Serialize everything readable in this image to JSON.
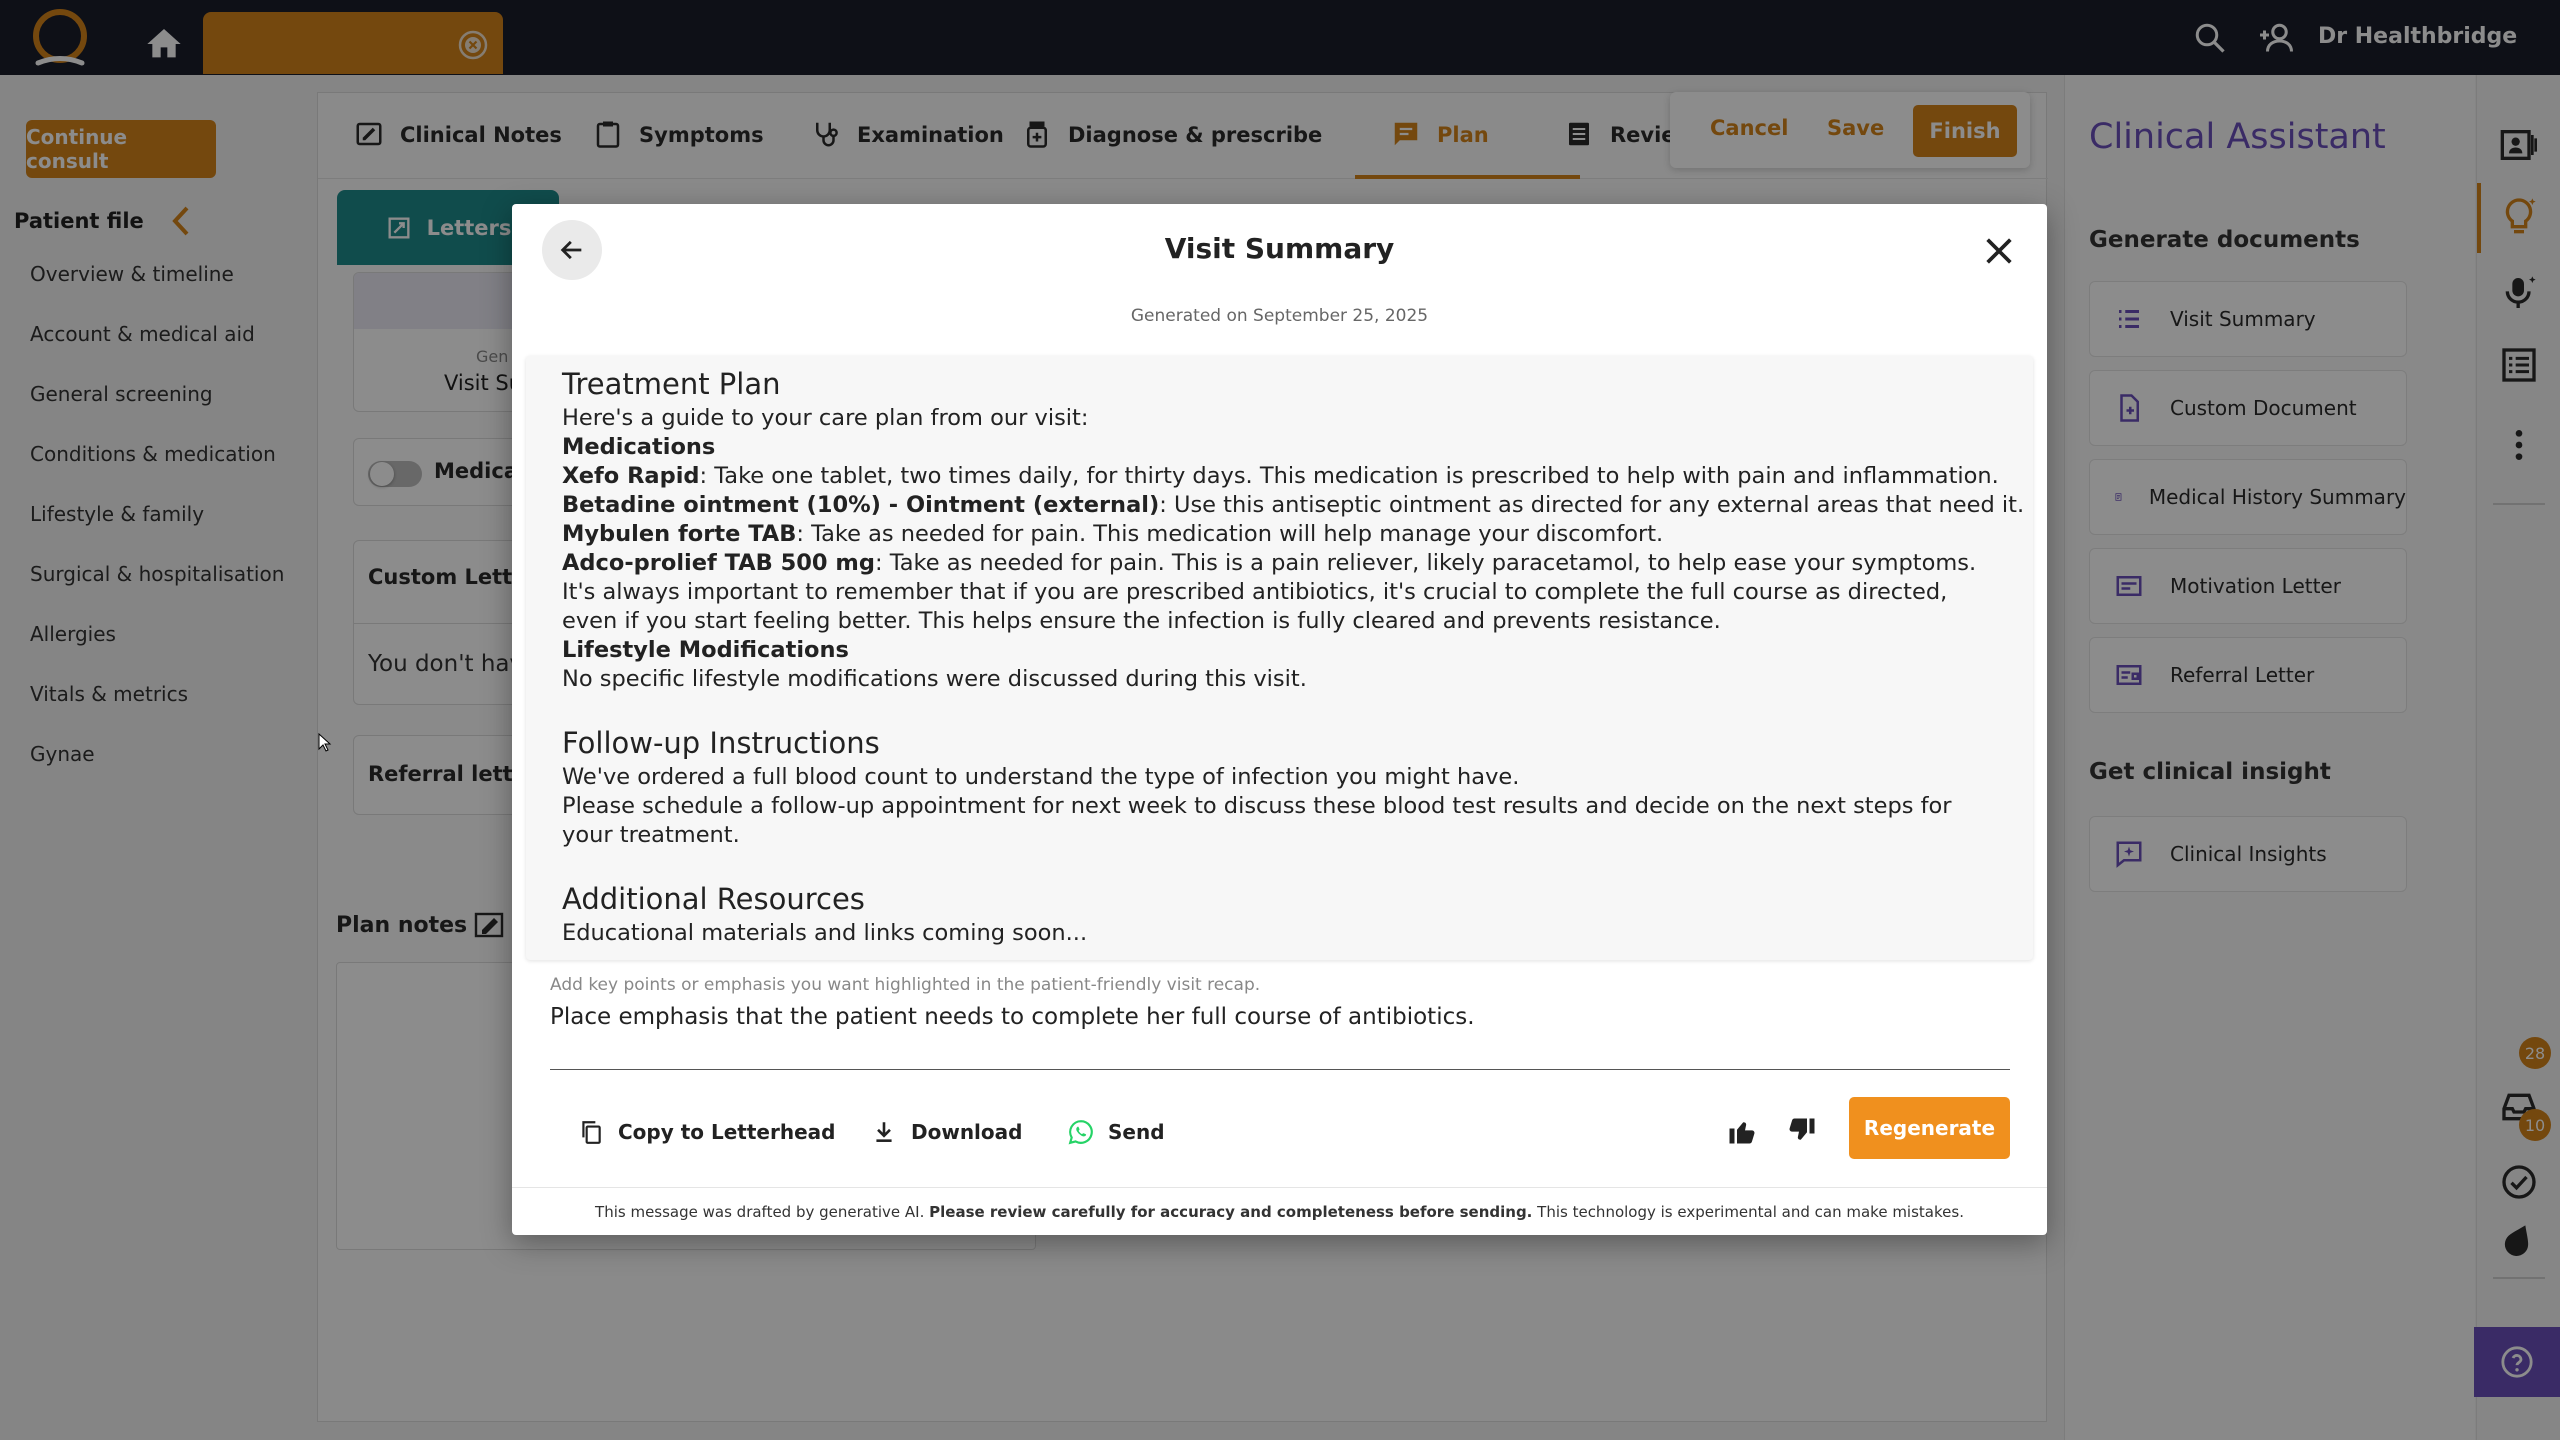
{
  "topbar": {
    "user_name": "Dr Healthbridge",
    "patient_tab_label": ""
  },
  "left_sidebar": {
    "continue_label": "Continue consult",
    "patient_file_title": "Patient file",
    "nav": [
      "Overview & timeline",
      "Account & medical aid",
      "General screening",
      "Conditions & medication",
      "Lifestyle & family",
      "Surgical & hospitalisation",
      "Allergies",
      "Vitals & metrics",
      "Gynae"
    ]
  },
  "consult": {
    "tabs": [
      "Clinical Notes",
      "Symptoms",
      "Examination",
      "Diagnose & prescribe",
      "Plan",
      "Review"
    ],
    "active_tab": "Plan",
    "cancel_label": "Cancel",
    "save_label": "Save",
    "finish_label": "Finish",
    "letters_tab": "Letters",
    "gen_card_small": "Gen",
    "gen_card_title": "Visit Su",
    "medica_label": "Medica",
    "custom_letters_title": "Custom Lette",
    "custom_letters_empty": "You don't hav",
    "referral_title": "Referral letter",
    "plan_notes_label": "Plan notes"
  },
  "assistant": {
    "title": "Clinical Assistant",
    "generate_heading": "Generate documents",
    "documents": [
      "Visit Summary",
      "Custom Document",
      "Medical History Summary",
      "Motivation Letter",
      "Referral Letter"
    ],
    "insight_heading": "Get clinical insight",
    "insight_button": "Clinical Insights"
  },
  "rail": {
    "badge_notifications": "28",
    "badge_tasks": "10"
  },
  "modal": {
    "title": "Visit Summary",
    "generated_on": "Generated on September 25, 2025",
    "summary": {
      "treatment_heading": "Treatment Plan",
      "intro": "Here's a guide to your care plan from our visit:",
      "medications_heading": "Medications",
      "meds": [
        {
          "name": "Xefo Rapid",
          "text": ": Take one tablet, two times daily, for thirty days. This medication is prescribed to help with pain and inflammation."
        },
        {
          "name": "Betadine ointment (10%) - Ointment (external)",
          "text": ": Use this antiseptic ointment as directed for any external areas that need it."
        },
        {
          "name": "Mybulen forte TAB",
          "text": ": Take as needed for pain. This medication will help manage your discomfort."
        },
        {
          "name": "Adco-prolief TAB 500 mg",
          "text": ": Take as needed for pain. This is a pain reliever, likely paracetamol, to help ease your symptoms."
        }
      ],
      "antibiotic_note": "It's always important to remember that if you are prescribed antibiotics, it's crucial to complete the full course as directed, even if you start feeling better. This helps ensure the infection is fully cleared and prevents resistance.",
      "lifestyle_heading": "Lifestyle Modifications",
      "lifestyle_text": "No specific lifestyle modifications were discussed during this visit.",
      "followup_heading": "Follow-up Instructions",
      "followup_1": "We've ordered a full blood count to understand the type of infection you might have.",
      "followup_2": "Please schedule a follow-up appointment for next week to discuss these blood test results and decide on the next steps for your treatment.",
      "resources_heading": "Additional Resources",
      "resources_text": "Educational materials and links coming soon..."
    },
    "emphasis_hint": "Add key points or emphasis you want highlighted in the patient-friendly visit recap.",
    "emphasis_value": "Place emphasis that the patient needs to complete her full course of antibiotics.",
    "copy_label": "Copy to Letterhead",
    "download_label": "Download",
    "send_label": "Send",
    "regenerate_label": "Regenerate",
    "disclaimer_start": "This message was drafted by generative AI. ",
    "disclaimer_bold": "Please review carefully for accuracy and completeness before sending.",
    "disclaimer_end": " This technology is experimental and can make mistakes."
  },
  "colors": {
    "brand_orange": "#d4831a",
    "assistant_purple": "#6b4fbb",
    "letters_teal": "#1e8b8b",
    "whatsapp_green": "#25d366"
  }
}
